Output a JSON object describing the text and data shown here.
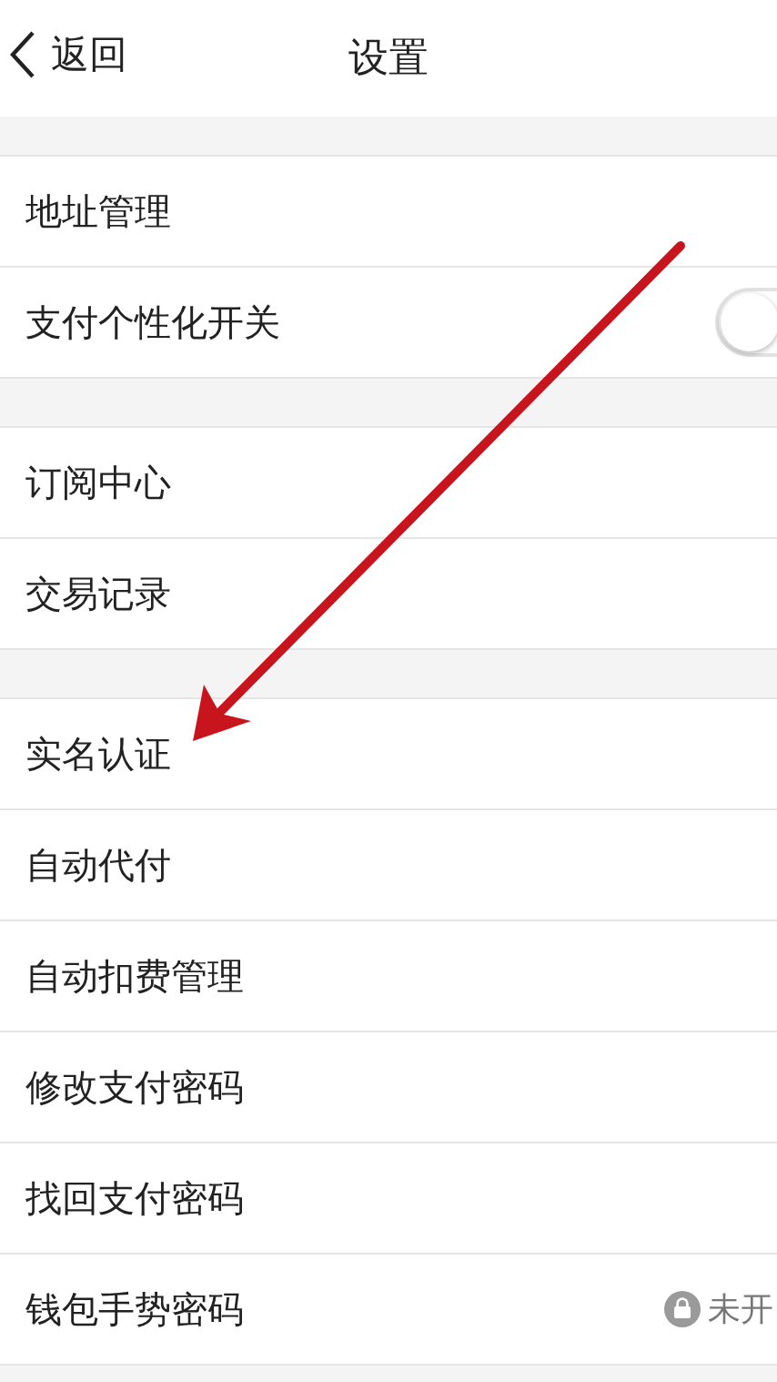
{
  "header": {
    "back": "返回",
    "title": "设置"
  },
  "sections": [
    {
      "rows": [
        {
          "label": "地址管理",
          "kind": "plain"
        },
        {
          "label": "支付个性化开关",
          "kind": "toggle",
          "on": false
        }
      ]
    },
    {
      "rows": [
        {
          "label": "订阅中心",
          "kind": "plain"
        },
        {
          "label": "交易记录",
          "kind": "plain"
        }
      ]
    },
    {
      "rows": [
        {
          "label": "实名认证",
          "kind": "plain"
        },
        {
          "label": "自动代付",
          "kind": "plain"
        },
        {
          "label": "自动扣费管理",
          "kind": "plain"
        },
        {
          "label": "修改支付密码",
          "kind": "plain"
        },
        {
          "label": "找回支付密码",
          "kind": "plain"
        },
        {
          "label": "钱包手势密码",
          "kind": "status",
          "status": "未开"
        }
      ]
    }
  ]
}
